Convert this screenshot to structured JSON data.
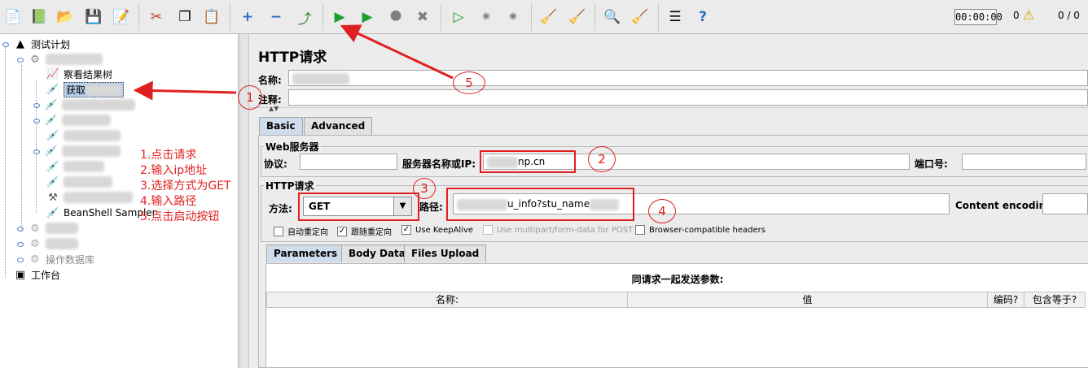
{
  "toolbar": {
    "timer": "00:00:00",
    "warning_count": "0",
    "thread_ratio": "0 / 0",
    "icons": [
      "new-icon",
      "templates-icon",
      "open-icon",
      "save-icon",
      "save-as-icon",
      "cut-icon",
      "copy-icon",
      "paste-icon",
      "expand-icon",
      "collapse-icon",
      "toggle-icon",
      "start-icon",
      "start-no-pause-icon",
      "stop-icon",
      "shutdown-icon",
      "remote-start-icon",
      "remote-stop-icon",
      "remote-shutdown-icon",
      "clear-icon",
      "clear-all-icon",
      "search-icon",
      "reset-search-icon",
      "function-helper-icon",
      "help-icon"
    ]
  },
  "tree": {
    "test_plan": "测试计划",
    "view_results_tree": "察看结果树",
    "selected_item": "获取",
    "beanshell": "BeanShell Sampler",
    "operate_db": "操作数据库",
    "workbench": "工作台"
  },
  "instructions": [
    "1.点击请求",
    "2.输入ip地址",
    "3.选择方式为GET",
    "4.输入路径",
    "5.点击启动按钮"
  ],
  "panel": {
    "title": "HTTP请求",
    "name_label": "名称:",
    "comment_label": "注释:",
    "tabs": [
      "Basic",
      "Advanced"
    ],
    "web_server": {
      "legend": "Web服务器",
      "protocol_label": "协议:",
      "protocol_value": "",
      "server_label": "服务器名称或IP:",
      "server_value": "np.cn",
      "port_label": "端口号:",
      "port_value": ""
    },
    "http_request": {
      "legend": "HTTP请求",
      "method_label": "方法:",
      "method_value": "GET",
      "path_label": "路径:",
      "path_value": "u_info?stu_name",
      "encoding_label": "Content encoding:",
      "encoding_value": ""
    },
    "checkboxes": [
      {
        "label": "自动重定向",
        "checked": false,
        "enabled": true
      },
      {
        "label": "跟随重定向",
        "checked": true,
        "enabled": true
      },
      {
        "label": "Use KeepAlive",
        "checked": true,
        "enabled": true
      },
      {
        "label": "Use multipart/form-data for POST",
        "checked": false,
        "enabled": false
      },
      {
        "label": "Browser-compatible headers",
        "checked": false,
        "enabled": true
      }
    ],
    "param_tabs": [
      "Parameters",
      "Body Data",
      "Files Upload"
    ],
    "params_caption": "同请求一起发送参数:",
    "columns": [
      "名称:",
      "值",
      "编码?",
      "包含等于?"
    ]
  },
  "annotations": {
    "circles": [
      "1",
      "2",
      "3",
      "4",
      "5"
    ]
  },
  "colors": {
    "annotation": "#e02020",
    "tab_active": "#cfdcec"
  }
}
